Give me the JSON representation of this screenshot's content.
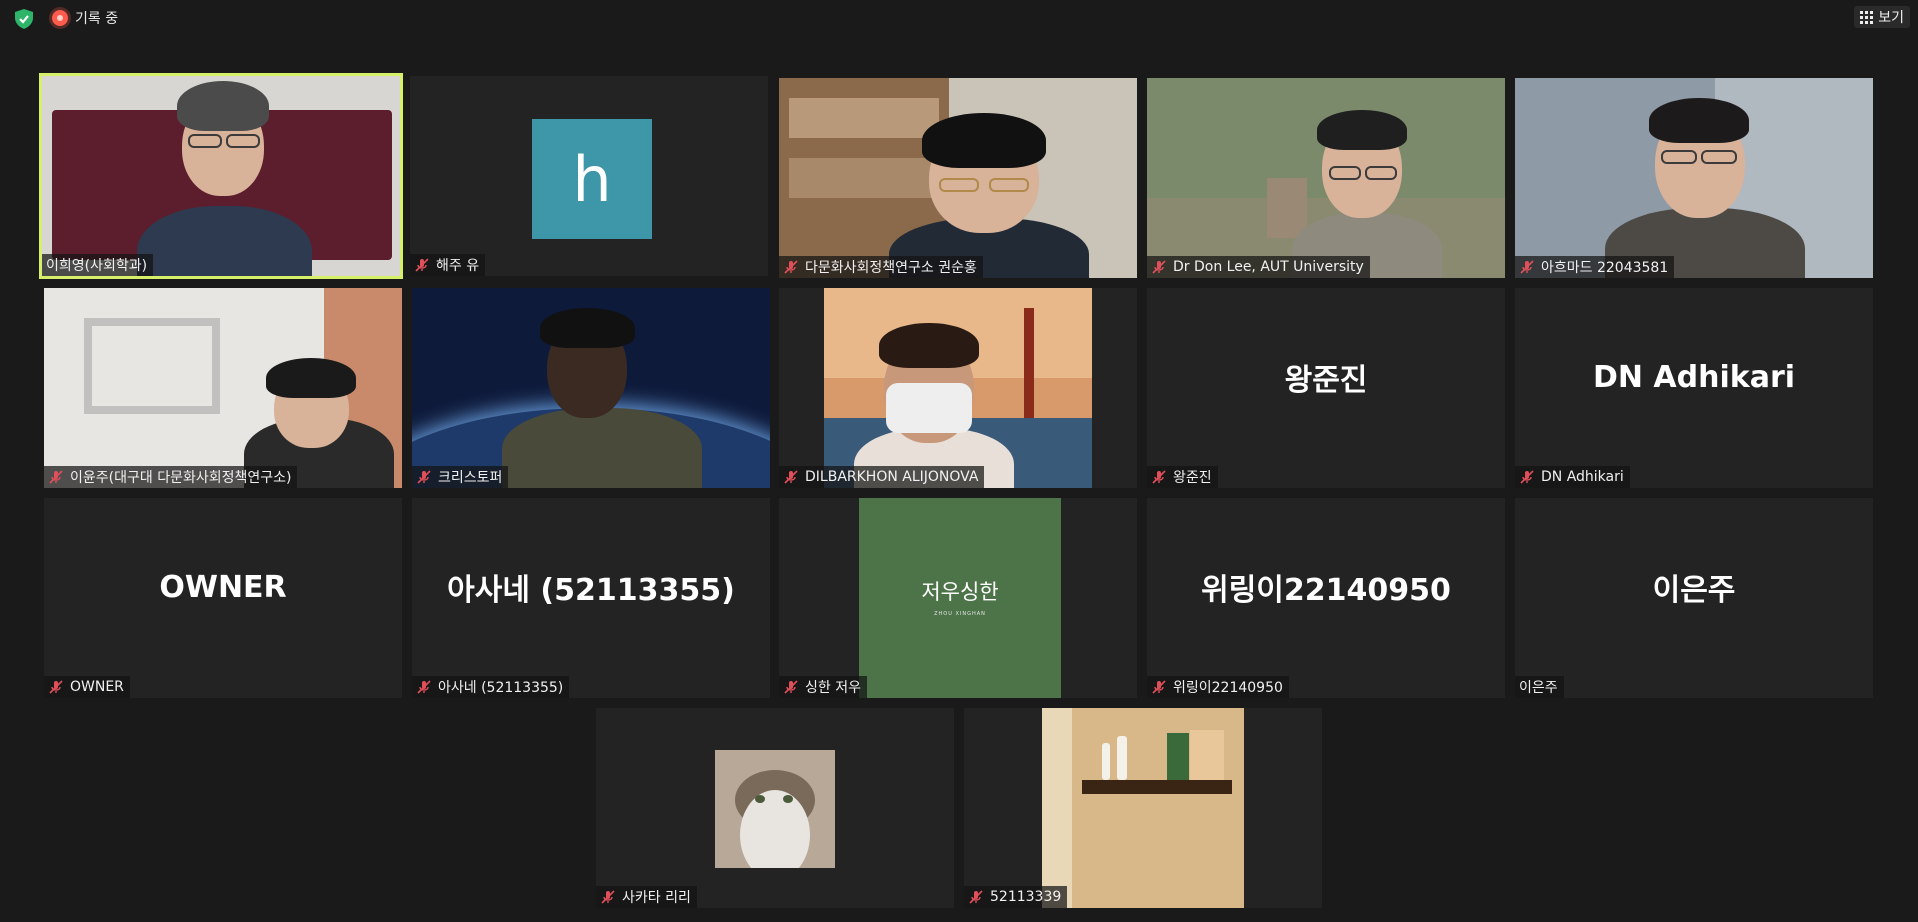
{
  "topbar": {
    "recording_label": "기록 중",
    "view_label": "보기"
  },
  "participants": [
    {
      "name": "이희영(사회학과)",
      "muted": false,
      "active_speaker": true
    },
    {
      "name": "해주 유",
      "muted": true,
      "avatar_letter": "h",
      "avatar_color": "#3d97a8"
    },
    {
      "name": "다문화사회정책연구소 권순홍",
      "muted": true
    },
    {
      "name": "Dr Don Lee, AUT University",
      "muted": true
    },
    {
      "name": "아흐마드 22043581",
      "muted": true
    },
    {
      "name": "이윤주(대구대 다문화사회정책연구소)",
      "muted": true
    },
    {
      "name": "크리스토퍼",
      "muted": true
    },
    {
      "name": "DILBARKHON ALIJONOVA",
      "muted": true
    },
    {
      "name": "왕준진",
      "muted": true,
      "display": "왕준진"
    },
    {
      "name": "DN Adhikari",
      "muted": true,
      "display": "DN Adhikari"
    },
    {
      "name": "OWNER",
      "muted": true,
      "display": "OWNER"
    },
    {
      "name": "아사네 (52113355)",
      "muted": true,
      "display": "아사네 (52113355)"
    },
    {
      "name": "싱한 저우",
      "muted": true,
      "card_title": "저우싱한",
      "card_subtitle": "ZHOU XINGHAN",
      "card_color": "#4d7449"
    },
    {
      "name": "위링이22140950",
      "muted": true,
      "display": "위링이22140950"
    },
    {
      "name": "이은주",
      "muted": false,
      "display": "이은주"
    },
    {
      "name": "사카타 리리",
      "muted": true
    },
    {
      "name": "52113339",
      "muted": true
    }
  ],
  "colors": {
    "background": "#1a1a1a",
    "tile": "#232323",
    "active_border": "#d7f06a",
    "muted_icon": "#e0505a",
    "recording": "#ff5b4d",
    "shield": "#2fb56a"
  }
}
